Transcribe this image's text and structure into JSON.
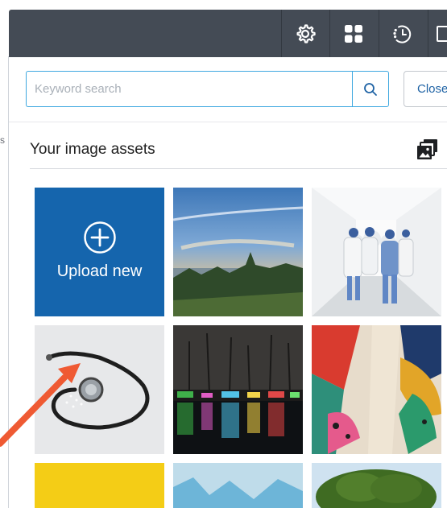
{
  "left_edge": {
    "glyph_1": "s",
    "glyph_2": "s"
  },
  "toolbar": {
    "buttons": [
      {
        "icon": "gear-icon"
      },
      {
        "icon": "grid-icon"
      },
      {
        "icon": "history-icon"
      },
      {
        "icon": "panel-icon"
      }
    ]
  },
  "search": {
    "placeholder": "Keyword search",
    "value": "",
    "button_icon": "search-icon"
  },
  "close_label": "Close",
  "assets": {
    "title": "Your image assets",
    "title_icon": "image-gallery-icon",
    "upload_label": "Upload new",
    "tiles": [
      {
        "name": "landscape-sunset-thumbnail"
      },
      {
        "name": "hospital-corridor-thumbnail"
      },
      {
        "name": "stethoscope-thumbnail"
      },
      {
        "name": "night-lake-lights-thumbnail"
      },
      {
        "name": "abstract-leaves-art-thumbnail"
      },
      {
        "name": "yellow-thumbnail"
      },
      {
        "name": "ice-blue-thumbnail"
      },
      {
        "name": "tree-thumbnail"
      }
    ]
  },
  "colors": {
    "toolbar": "#444b55",
    "accent": "#1565ad",
    "input_border": "#3fa8e0",
    "annotation_arrow": "#ef5a33"
  }
}
